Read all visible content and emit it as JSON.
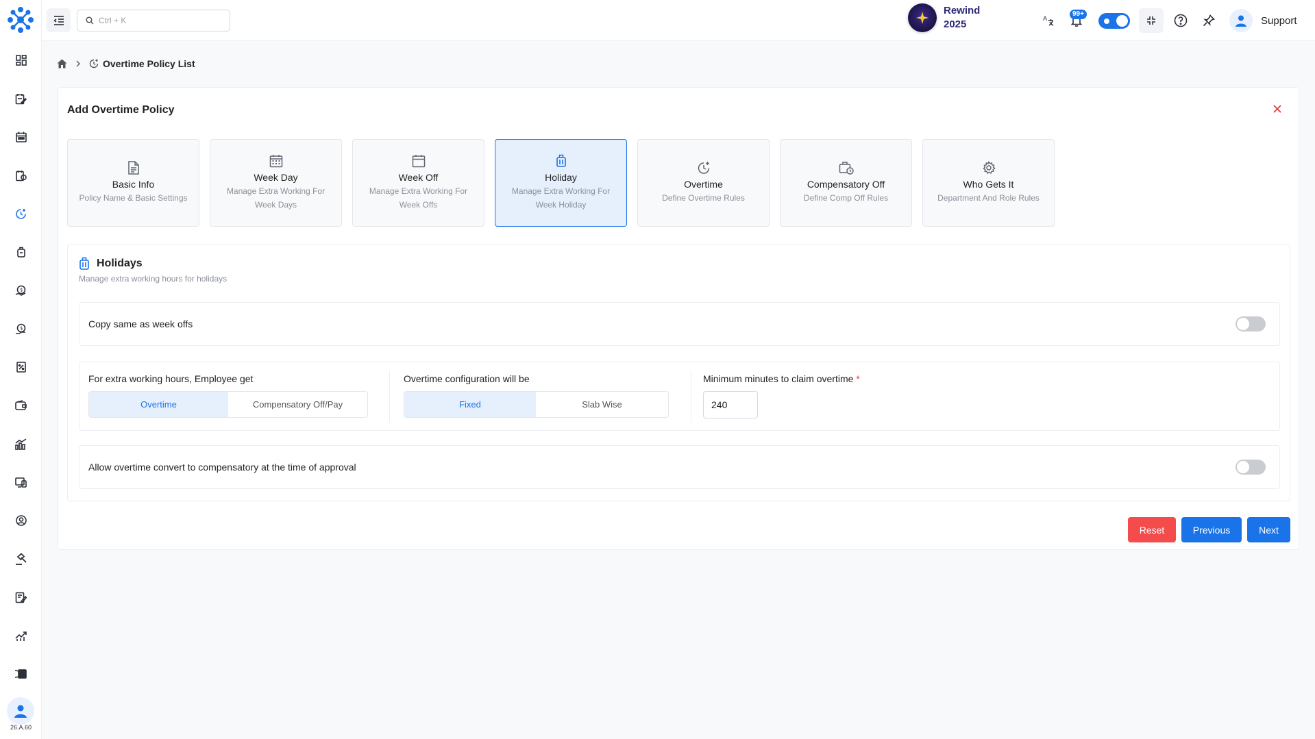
{
  "colors": {
    "accent": "#1a73e8",
    "danger": "#f44c4c",
    "rewind": "#2d2a78"
  },
  "search": {
    "placeholder": "Ctrl + K"
  },
  "topbar": {
    "rewind_line1": "Rewind",
    "rewind_line2": "2025",
    "notif_count": "99+",
    "support_label": "Support"
  },
  "sidebar": {
    "version": "26.A.60",
    "items": [
      {
        "icon": "dashboard-icon"
      },
      {
        "icon": "attendance-icon"
      },
      {
        "icon": "calendar-icon"
      },
      {
        "icon": "leave-icon"
      },
      {
        "icon": "overtime-clock-icon",
        "active": true
      },
      {
        "icon": "bag-icon"
      },
      {
        "icon": "reimbursement-icon"
      },
      {
        "icon": "payroll-icon"
      },
      {
        "icon": "tax-icon"
      },
      {
        "icon": "wallet-icon"
      },
      {
        "icon": "analytics-icon"
      },
      {
        "icon": "assets-icon"
      },
      {
        "icon": "profile-icon"
      },
      {
        "icon": "gavel-icon"
      },
      {
        "icon": "notes-icon"
      },
      {
        "icon": "reports-icon"
      },
      {
        "icon": "settings-card-icon"
      }
    ]
  },
  "breadcrumb": {
    "current": "Overtime Policy List"
  },
  "card": {
    "title": "Add Overtime Policy"
  },
  "steps": [
    {
      "title": "Basic Info",
      "desc": "Policy Name & Basic Settings"
    },
    {
      "title": "Week Day",
      "desc": "Manage Extra Working For Week Days"
    },
    {
      "title": "Week Off",
      "desc": "Manage Extra Working For Week Offs"
    },
    {
      "title": "Holiday",
      "desc": "Manage Extra Working For Week Holiday",
      "active": true
    },
    {
      "title": "Overtime",
      "desc": "Define Overtime Rules"
    },
    {
      "title": "Compensatory Off",
      "desc": "Define Comp Off Rules"
    },
    {
      "title": "Who Gets It",
      "desc": "Department And Role Rules"
    }
  ],
  "holidays": {
    "title": "Holidays",
    "subtitle": "Manage extra working hours for holidays",
    "copy_label": "Copy same as week offs",
    "copy_enabled": false,
    "extra_label": "For extra working hours, Employee get",
    "extra_options": [
      "Overtime",
      "Compensatory Off/Pay"
    ],
    "extra_selected": "Overtime",
    "config_label": "Overtime configuration will be",
    "config_options": [
      "Fixed",
      "Slab Wise"
    ],
    "config_selected": "Fixed",
    "min_label": "Minimum minutes to claim overtime",
    "min_required": "*",
    "min_value": "240",
    "convert_label": "Allow overtime convert to compensatory at the time of approval",
    "convert_enabled": false
  },
  "actions": {
    "reset": "Reset",
    "previous": "Previous",
    "next": "Next"
  }
}
